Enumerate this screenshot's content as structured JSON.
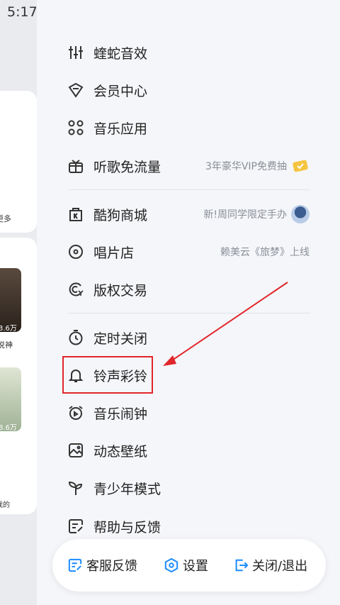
{
  "status": {
    "time": "5:17"
  },
  "background_app": {
    "more_label": "更多",
    "count1": "3.6万",
    "title1": "说神",
    "count2": "8.6万",
    "mine_label": "我的"
  },
  "menu": {
    "group1": [
      {
        "icon": "equalizer-icon",
        "label": "蝰蛇音效"
      },
      {
        "icon": "diamond-icon",
        "label": "会员中心"
      },
      {
        "icon": "grid-apps-icon",
        "label": "音乐应用"
      },
      {
        "icon": "gift-box-icon",
        "label": "听歌免流量",
        "sub": "3年豪华VIP免费抽"
      }
    ],
    "group2": [
      {
        "icon": "shop-k-icon",
        "label": "酷狗商城",
        "sub": "新!周同学限定手办"
      },
      {
        "icon": "disc-icon",
        "label": "唱片店",
        "sub": "赖美云《旅梦》上线"
      },
      {
        "icon": "copyright-icon",
        "label": "版权交易"
      }
    ],
    "group3": [
      {
        "icon": "timer-icon",
        "label": "定时关闭"
      },
      {
        "icon": "bell-icon",
        "label": "铃声彩铃"
      },
      {
        "icon": "alarm-clock-icon",
        "label": "音乐闹钟"
      },
      {
        "icon": "wallpaper-icon",
        "label": "动态壁纸"
      },
      {
        "icon": "sprout-icon",
        "label": "青少年模式"
      },
      {
        "icon": "feedback-icon",
        "label": "帮助与反馈"
      }
    ]
  },
  "bottom_bar": {
    "customer_service": "客服反馈",
    "settings": "设置",
    "exit": "关闭/退出"
  },
  "colors": {
    "accent": "#1a8cff",
    "highlight": "#e0262b"
  }
}
